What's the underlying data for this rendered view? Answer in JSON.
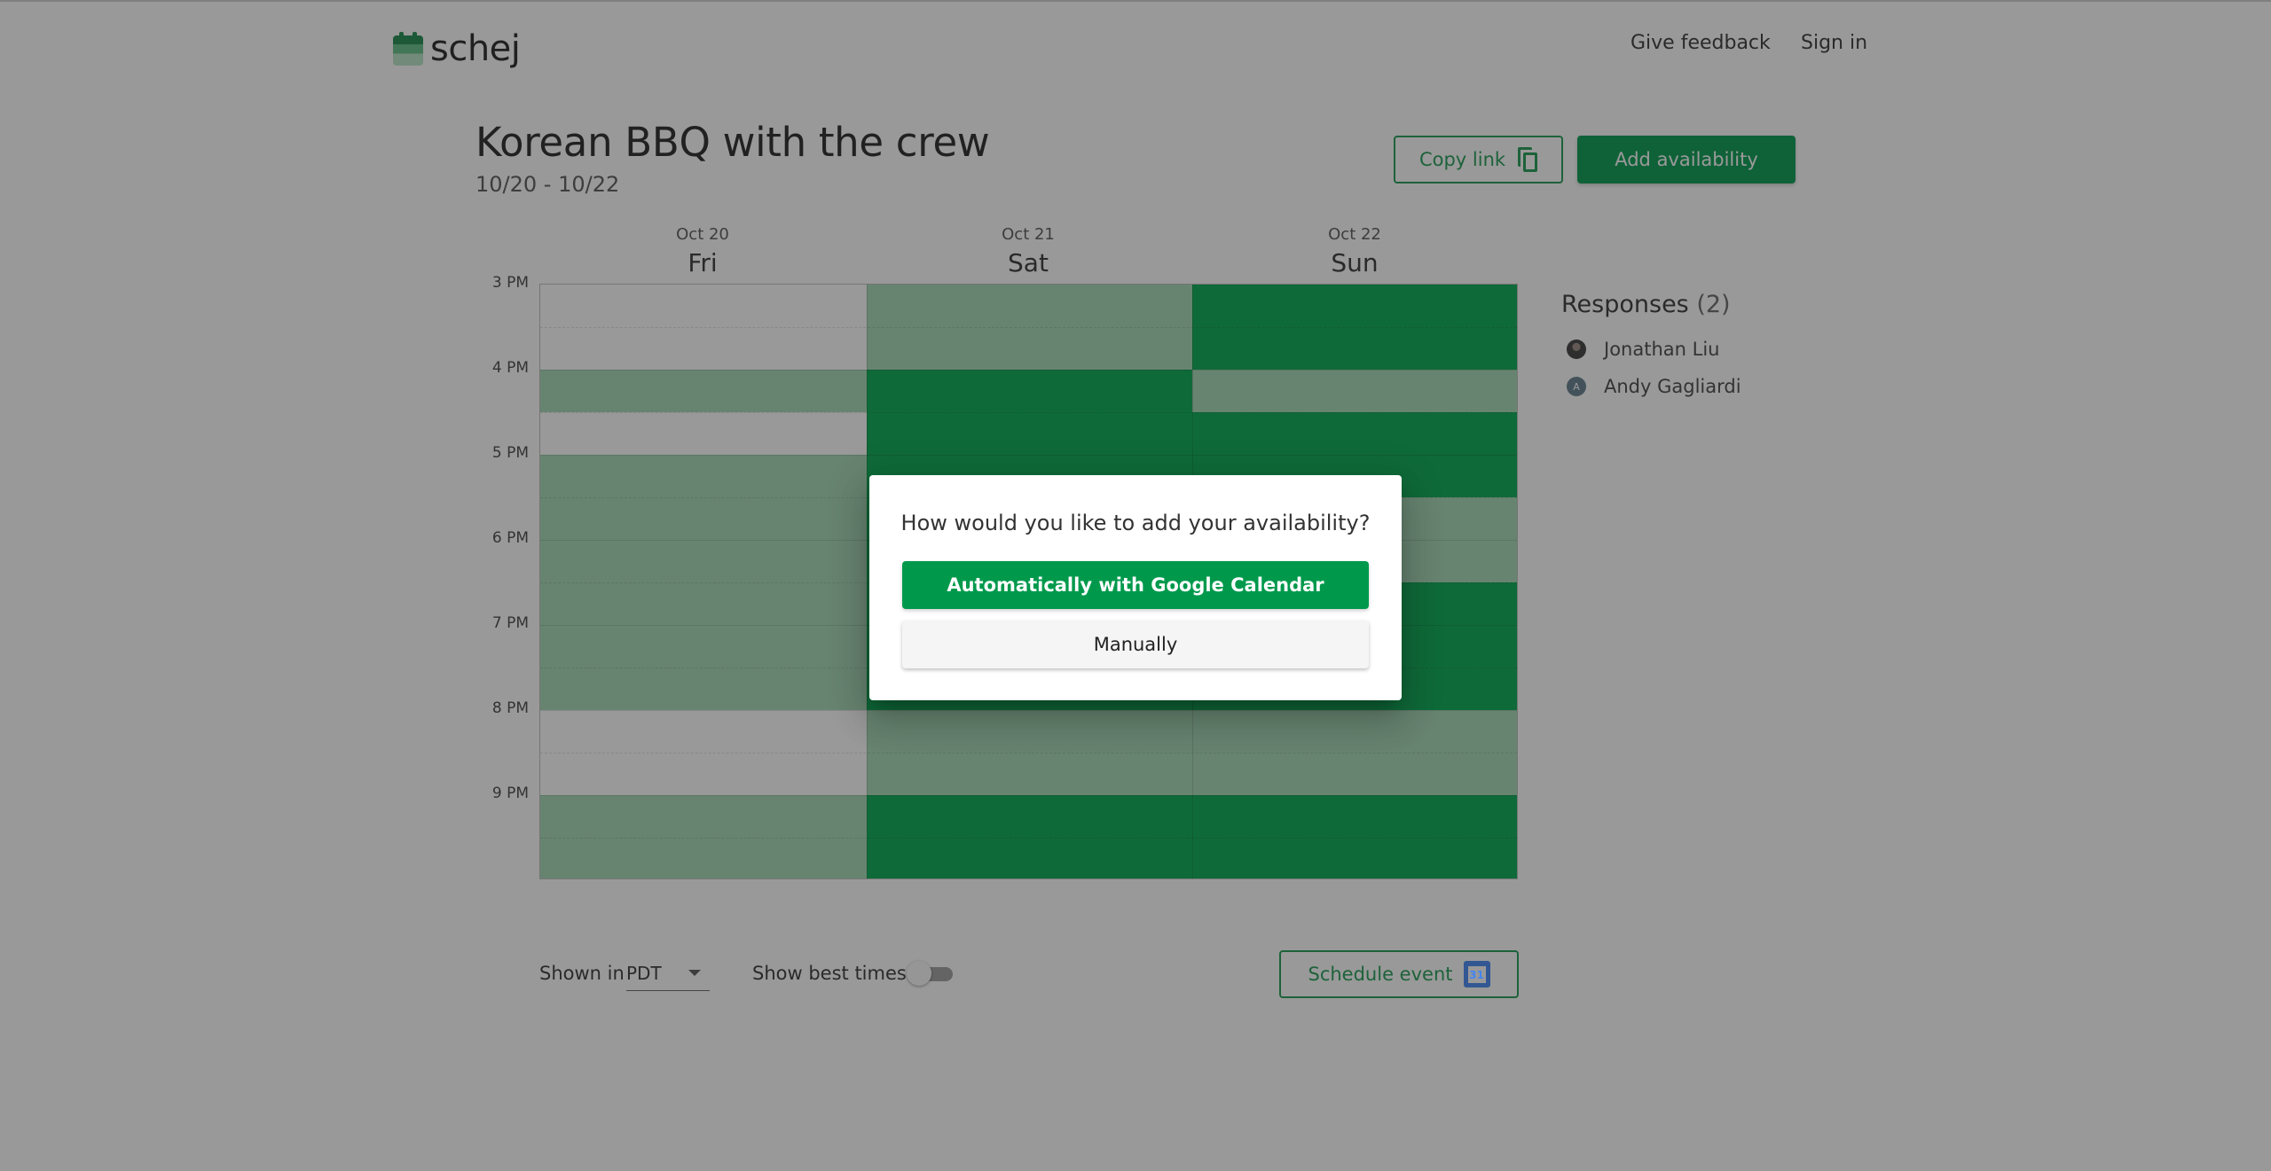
{
  "header": {
    "logo_text": "schej",
    "nav": [
      "Give feedback",
      "Sign in"
    ]
  },
  "event": {
    "title": "Korean BBQ with the crew",
    "date_range": "10/20 - 10/22",
    "copy_link_label": "Copy link",
    "add_availability_label": "Add availability"
  },
  "grid": {
    "days": [
      {
        "date": "Oct 20",
        "weekday": "Fri"
      },
      {
        "date": "Oct 21",
        "weekday": "Sat"
      },
      {
        "date": "Oct 22",
        "weekday": "Sun"
      }
    ],
    "hours": [
      "3 PM",
      "4 PM",
      "5 PM",
      "6 PM",
      "7 PM",
      "8 PM",
      "9 PM"
    ],
    "availability_levels_by_half_hour": [
      [
        0,
        0,
        1,
        0,
        1,
        1,
        1,
        1,
        1,
        1,
        0,
        0,
        1,
        1
      ],
      [
        1,
        1,
        2,
        2,
        2,
        2,
        2,
        2,
        2,
        2,
        1,
        1,
        2,
        2
      ],
      [
        2,
        2,
        1,
        2,
        2,
        1,
        1,
        2,
        2,
        2,
        1,
        1,
        2,
        2
      ]
    ],
    "colors": {
      "none": "#ffffff",
      "some": "#a3d9b4",
      "all": "#00a84f"
    }
  },
  "responses": {
    "title": "Responses",
    "count": "(2)",
    "people": [
      {
        "name": "Jonathan Liu",
        "avatar": "photo"
      },
      {
        "name": "Andy Gagliardi",
        "avatar": "A"
      }
    ]
  },
  "footer": {
    "shown_in_label": "Shown in",
    "timezone": "PDT",
    "best_times_label": "Show best times",
    "best_times_enabled": false,
    "schedule_label": "Schedule event",
    "gcal_day": "31"
  },
  "dialog": {
    "question": "How would you like to add your availability?",
    "google_label": "Automatically with Google Calendar",
    "manual_label": "Manually"
  },
  "theme": {
    "accent": "#00994c",
    "overlay": "rgba(33,33,33,0.46)"
  }
}
